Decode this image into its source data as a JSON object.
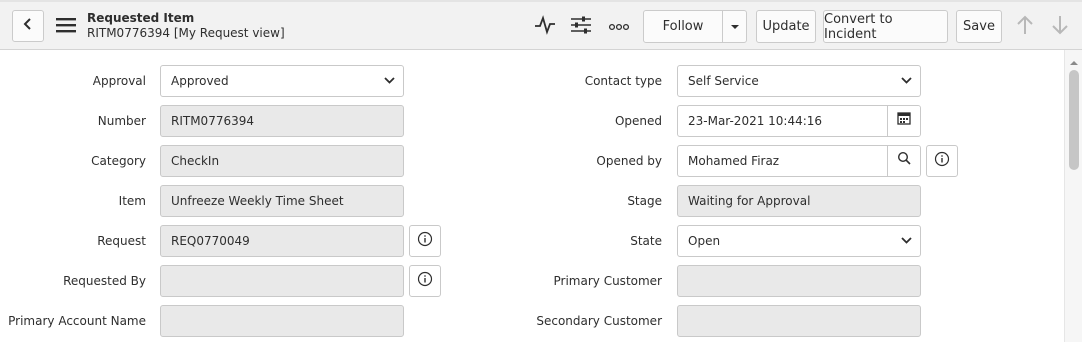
{
  "header": {
    "record_type": "Requested Item",
    "record_subtitle": "RITM0776394 [My Request view]",
    "icons": [
      "back-arrow-icon",
      "hamburger-menu-icon",
      "activity-pulse-icon",
      "personalize-form-icon",
      "more-options-icon",
      "up-arrow-icon",
      "down-arrow-icon"
    ],
    "follow_label": "Follow",
    "update_label": "Update",
    "convert_label": "Convert to Incident",
    "save_label": "Save"
  },
  "form": {
    "left": {
      "approval": {
        "label": "Approval",
        "value": "Approved"
      },
      "number": {
        "label": "Number",
        "value": "RITM0776394"
      },
      "category": {
        "label": "Category",
        "value": "CheckIn"
      },
      "item": {
        "label": "Item",
        "value": "Unfreeze Weekly Time Sheet"
      },
      "request": {
        "label": "Request",
        "value": "REQ0770049"
      },
      "requested_by": {
        "label": "Requested By",
        "value": ""
      },
      "primary_account_name": {
        "label": "Primary Account Name",
        "value": ""
      }
    },
    "right": {
      "contact_type": {
        "label": "Contact type",
        "value": "Self Service"
      },
      "opened": {
        "label": "Opened",
        "value": "23-Mar-2021 10:44:16"
      },
      "opened_by": {
        "label": "Opened by",
        "value": "Mohamed Firaz"
      },
      "stage": {
        "label": "Stage",
        "value": "Waiting for Approval"
      },
      "state": {
        "label": "State",
        "value": "Open"
      },
      "primary_customer": {
        "label": "Primary Customer",
        "value": ""
      },
      "secondary_customer": {
        "label": "Secondary Customer",
        "value": ""
      }
    }
  },
  "colors": {
    "header_bg": "#f2f2f2",
    "readonly_bg": "#e9e9e9",
    "border": "#c9c9c9"
  }
}
